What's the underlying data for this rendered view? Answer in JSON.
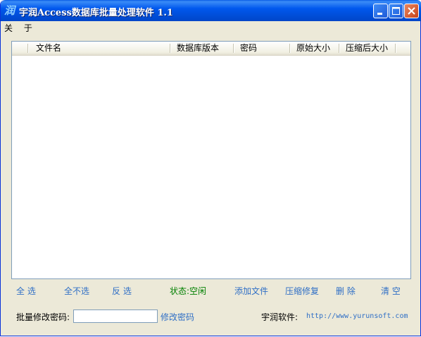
{
  "window": {
    "title": "宇润Access数据库批量处理软件 1.1",
    "icon_glyph": "润"
  },
  "menu": {
    "about": "关 于"
  },
  "list": {
    "columns": [
      "文件名",
      "数据库版本",
      "密码",
      "原始大小",
      "压缩后大小"
    ],
    "rows": []
  },
  "actions": {
    "select_all": "全 选",
    "select_none": "全不选",
    "invert": "反 选",
    "status": "状态:空闲",
    "add_files": "添加文件",
    "compact_repair": "压缩修复",
    "delete": "删 除",
    "clear": "清 空"
  },
  "footer": {
    "batch_password_label": "批量修改密码:",
    "batch_password_value": "",
    "change_password": "修改密码",
    "vendor_label": "宇润软件:",
    "vendor_url": "http://www.yurunsoft.com"
  },
  "colors": {
    "titlebar": "#0052e0",
    "link": "#2f6fc6",
    "status": "#008000",
    "window_bg": "#ece9d8"
  }
}
